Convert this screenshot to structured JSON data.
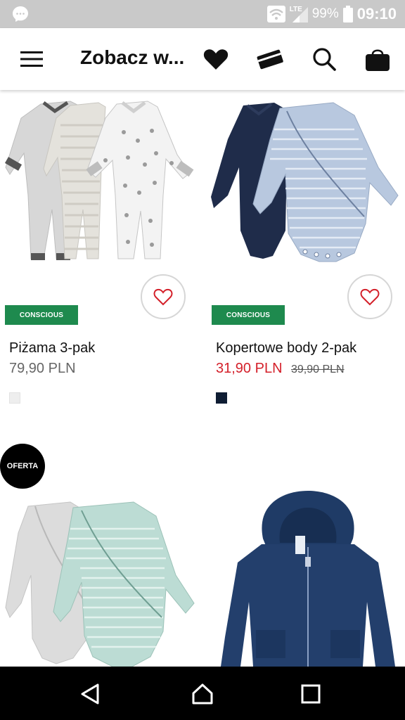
{
  "status_bar": {
    "network": "LTE",
    "battery": "99%",
    "time": "09:10",
    "icons": [
      "messenger-icon",
      "wifi-icon",
      "signal-icon",
      "battery-icon"
    ]
  },
  "app_bar": {
    "title": "Zobacz w...",
    "icons": [
      "menu-icon",
      "heart-icon",
      "card-icon",
      "search-icon",
      "bag-icon"
    ]
  },
  "products": [
    {
      "name": "Piżama 3-pak",
      "price": "79,90 PLN",
      "old_price": "",
      "badge": "CONSCIOUS",
      "swatch_color": "#eeeeee",
      "sale": false
    },
    {
      "name": "Kopertowe body 2-pak",
      "price": "31,90 PLN",
      "old_price": "39,90 PLN",
      "badge": "CONSCIOUS",
      "swatch_color": "#0f1d33",
      "sale": true
    },
    {
      "promo": "OFERTA"
    },
    {}
  ],
  "colors": {
    "badge_green": "#1e8a4e",
    "sale_red": "#d4202a",
    "status_gray": "#c9c9c9"
  },
  "nav_bar": {
    "icons": [
      "back-icon",
      "home-icon",
      "recents-icon"
    ]
  }
}
